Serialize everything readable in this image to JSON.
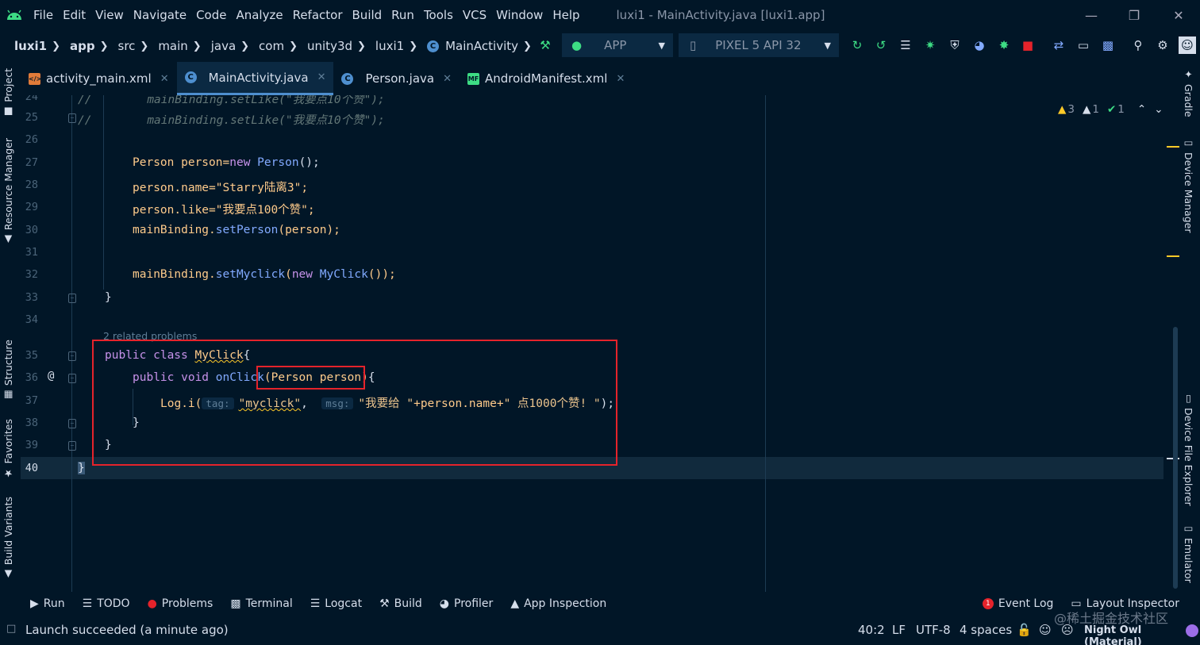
{
  "menu": {
    "items": [
      "File",
      "Edit",
      "View",
      "Navigate",
      "Code",
      "Analyze",
      "Refactor",
      "Build",
      "Run",
      "Tools",
      "VCS",
      "Window",
      "Help"
    ],
    "title": "luxi1 - MainActivity.java [luxi1.app]"
  },
  "breadcrumb": {
    "items": [
      "luxi1",
      "app",
      "src",
      "main",
      "java",
      "com",
      "unity3d",
      "luxi1",
      "MainActivity"
    ]
  },
  "toolbar": {
    "run_config": "APP",
    "device": "PIXEL 5 API 32"
  },
  "left_tools": {
    "project": "Project",
    "resource_manager": "Resource Manager",
    "structure": "Structure",
    "favorites": "Favorites",
    "build_variants": "Build Variants"
  },
  "right_tools": {
    "gradle": "Gradle",
    "device_manager": "Device Manager",
    "device_file_explorer": "Device File Explorer",
    "emulator": "Emulator"
  },
  "tabs": [
    {
      "label": "activity_main.xml",
      "icon": "xml-file-icon"
    },
    {
      "label": "MainActivity.java",
      "icon": "java-class-icon",
      "active": true
    },
    {
      "label": "Person.java",
      "icon": "java-class-icon"
    },
    {
      "label": "AndroidManifest.xml",
      "icon": "manifest-icon"
    }
  ],
  "inspections": {
    "warnings": "3",
    "weak_warnings": "1",
    "typos": "1"
  },
  "editor": {
    "line_numbers": [
      "24",
      "25",
      "26",
      "27",
      "28",
      "29",
      "30",
      "31",
      "32",
      "33",
      "34",
      "35",
      "36",
      "37",
      "38",
      "39",
      "40"
    ],
    "related_problems": "2 related problems",
    "line_24": {
      "comment_prefix": "//",
      "text": "mainBinding.setLike(\"我要点10个赞\");"
    },
    "line_25": {
      "comment_prefix": "//",
      "text": "mainBinding.setLike(\"我要点10个赞\");"
    },
    "line_27": {
      "t1": "Person",
      "t2": " person=",
      "kw": "new",
      "t3": " ",
      "ty": "Person",
      "t4": "();"
    },
    "line_28": {
      "t1": "person.name=",
      "str": "\"Starry陆离3\"",
      "t2": ";"
    },
    "line_29": {
      "t1": "person.like=",
      "str": "\"我要点100个赞\"",
      "t2": ";"
    },
    "line_30": {
      "obj": "mainBinding.",
      "fn": "setPerson",
      "t1": "(person);"
    },
    "line_32": {
      "obj": "mainBinding.",
      "fn": "setMyclick",
      "t1": "(",
      "kw": "new",
      "t2": " ",
      "ty": "MyClick",
      "t3": "());"
    },
    "line_33": "}",
    "line_35": {
      "kw": "public class",
      "t1": " ",
      "ty": "MyClick",
      "t2": "{"
    },
    "line_36": {
      "kw": "public void",
      "t1": " ",
      "fn": "onClick",
      "t2": "(Person person)",
      "t3": "{"
    },
    "line_37": {
      "t1": "Log.i(",
      "hint1": "tag:",
      "str1": "\"myclick\"",
      "t2": ", ",
      "hint2": "msg:",
      "str2": "\"我要给 \"",
      "t3": "+person.name+",
      "str3": "\" 点1000个赞! \"",
      "t4": ");"
    },
    "line_38": "}",
    "line_39": "}",
    "line_40": "}"
  },
  "bottom_tools": {
    "run": "Run",
    "todo": "TODO",
    "problems": "Problems",
    "terminal": "Terminal",
    "logcat": "Logcat",
    "build": "Build",
    "profiler": "Profiler",
    "app_inspection": "App Inspection",
    "event_log": "Event Log",
    "event_log_count": "1",
    "layout_inspector": "Layout Inspector"
  },
  "status": {
    "message": "Launch succeeded (a minute ago)",
    "position": "40:2",
    "line_sep": "LF",
    "encoding": "UTF-8",
    "indent": "4 spaces",
    "theme": "Night Owl (Material)",
    "watermark": "@稀土掘金技术社区"
  }
}
